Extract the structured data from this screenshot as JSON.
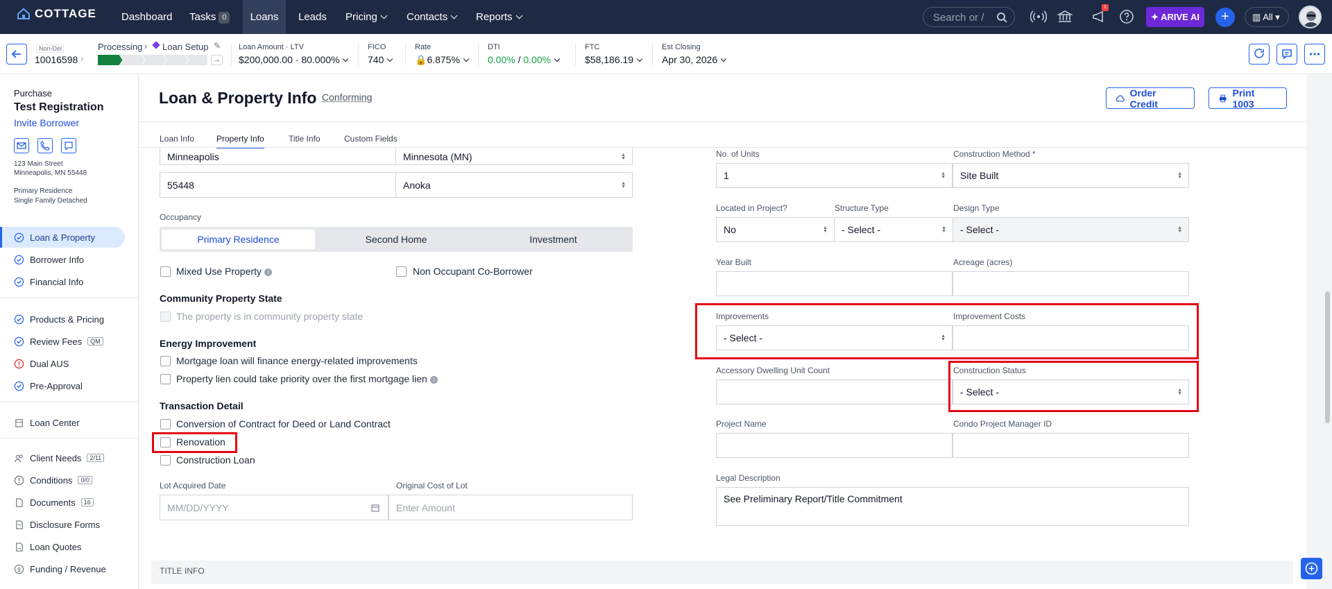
{
  "nav": {
    "logo": "COTTAGE",
    "items": [
      "Dashboard",
      "Tasks",
      "Loans",
      "Leads",
      "Pricing",
      "Contacts",
      "Reports"
    ],
    "tasks_count": "0",
    "search_placeholder": "Search or /",
    "notification_count": "1",
    "arive_ai": "ARIVE AI",
    "all_label": "All"
  },
  "loan": {
    "non_del": "Non-Del",
    "number": "10016598",
    "stage": "Processing",
    "substage": "Loan Setup",
    "progress_fraction": 0.2,
    "amount_label": "Loan Amount · LTV",
    "amount": "$200,000.00",
    "ltv": "80.000%",
    "fico_label": "FICO",
    "fico": "740",
    "rate_label": "Rate",
    "rate": "6.875%",
    "dti_label": "DTI",
    "dti_a": "0.00%",
    "dti_sep": "/",
    "dti_b": "0.00%",
    "ftc_label": "FTC",
    "ftc": "$58,186.19",
    "closing_label": "Est Closing",
    "closing": "Apr 30, 2026"
  },
  "sidebar": {
    "purpose": "Purchase",
    "borrower": "Test Registration",
    "invite": "Invite Borrower",
    "address1": "123 Main Street",
    "address2": "Minneapolis, MN 55448",
    "occupancy": "Primary Residence",
    "property_type": "Single Family Detached",
    "items": [
      {
        "label": "Loan & Property",
        "status": "check",
        "active": true
      },
      {
        "label": "Borrower Info",
        "status": "check"
      },
      {
        "label": "Financial Info",
        "status": "check"
      },
      {
        "label": "Products & Pricing",
        "status": "check"
      },
      {
        "label": "Review Fees",
        "status": "check",
        "badge": "QM"
      },
      {
        "label": "Dual AUS",
        "status": "alert"
      },
      {
        "label": "Pre-Approval",
        "status": "check"
      },
      {
        "label": "Loan Center",
        "status": "building"
      },
      {
        "label": "Client Needs",
        "status": "people",
        "badge": "2/11"
      },
      {
        "label": "Conditions",
        "status": "alert-gray",
        "badge": "0/0"
      },
      {
        "label": "Documents",
        "status": "doc",
        "badge": "16"
      },
      {
        "label": "Disclosure Forms",
        "status": "doc"
      },
      {
        "label": "Loan Quotes",
        "status": "doc"
      },
      {
        "label": "Funding / Revenue",
        "status": "money"
      }
    ]
  },
  "page": {
    "title": "Loan & Property Info",
    "loan_type": "Conforming",
    "order_credit": "Order Credit",
    "print": "Print 1003",
    "tabs": [
      "Loan Info",
      "Property Info",
      "Title Info",
      "Custom Fields"
    ],
    "active_tab": "Property Info"
  },
  "left": {
    "city": "Minneapolis",
    "state": "Minnesota (MN)",
    "zip": "55448",
    "county": "Anoka",
    "occupancy_label": "Occupancy",
    "occupancy_options": [
      "Primary Residence",
      "Second Home",
      "Investment"
    ],
    "mixed_use": "Mixed Use Property",
    "non_occupant": "Non Occupant Co-Borrower",
    "community_heading": "Community Property State",
    "community_cb": "The property is in community property state",
    "energy_heading": "Energy Improvement",
    "energy_cb1": "Mortgage loan will finance energy-related improvements",
    "energy_cb2": "Property lien could take priority over the first mortgage lien",
    "transaction_heading": "Transaction Detail",
    "txn_cb1": "Conversion of Contract for Deed or Land Contract",
    "txn_cb2": "Renovation",
    "txn_cb3": "Construction Loan",
    "lot_date_label": "Lot Acquired Date",
    "lot_date_placeholder": "MM/DD/YYYY",
    "lot_cost_label": "Original Cost of Lot",
    "lot_cost_placeholder": "Enter Amount"
  },
  "right": {
    "units_label": "No. of Units",
    "units": "1",
    "construction_method_label": "Construction Method *",
    "construction_method": "Site Built",
    "in_project_label": "Located in Project?",
    "in_project": "No",
    "structure_label": "Structure Type",
    "structure": "- Select -",
    "design_label": "Design Type",
    "design": "- Select -",
    "year_built_label": "Year Built",
    "acreage_label": "Acreage (acres)",
    "improvements_label": "Improvements",
    "improvements": "- Select -",
    "improvement_costs_label": "Improvement Costs",
    "adu_label": "Accessory Dwelling Unit Count",
    "construction_status_label": "Construction Status",
    "construction_status": "- Select -",
    "project_name_label": "Project Name",
    "condo_label": "Condo Project Manager ID",
    "legal_label": "Legal Description",
    "legal": "See Preliminary Report/Title Commitment"
  },
  "footer": {
    "title_info": "TITLE INFO"
  },
  "colors": {
    "nav_bg": "#1e2a44",
    "accent": "#2563eb",
    "highlight": "#e30613",
    "progress": "#15803d",
    "arive": "#6d28d9"
  }
}
